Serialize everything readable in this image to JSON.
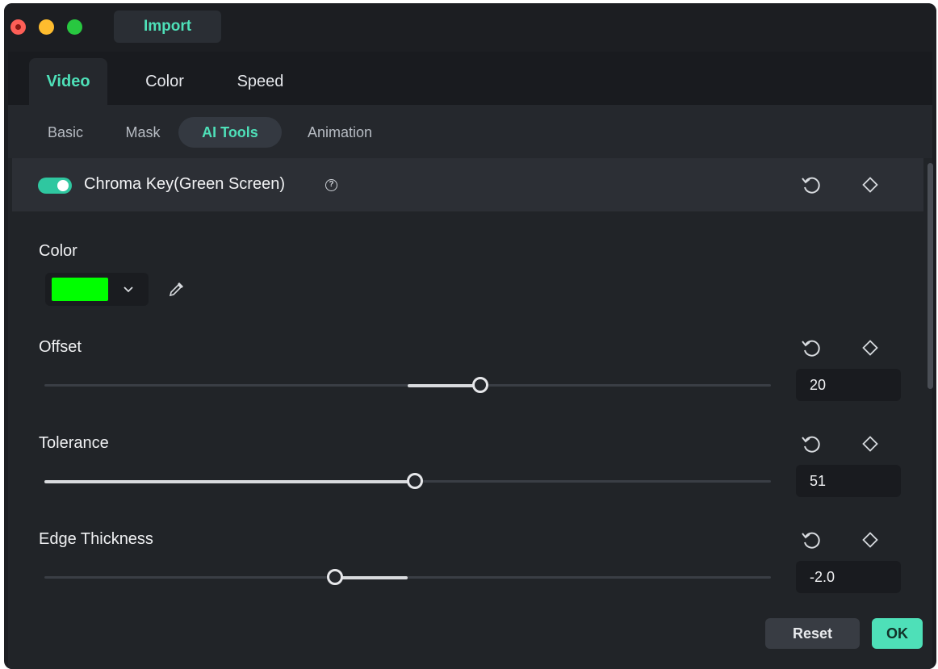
{
  "titlebar": {
    "import_label": "Import"
  },
  "tabs": [
    {
      "label": "Video",
      "active": true
    },
    {
      "label": "Color",
      "active": false
    },
    {
      "label": "Speed",
      "active": false
    }
  ],
  "subtabs": [
    {
      "label": "Basic",
      "active": false
    },
    {
      "label": "Mask",
      "active": false
    },
    {
      "label": "AI Tools",
      "active": true
    },
    {
      "label": "Animation",
      "active": false
    }
  ],
  "section": {
    "title": "Chroma Key(Green Screen)",
    "enabled": true,
    "help_glyph": "?"
  },
  "color": {
    "label": "Color",
    "value": "#00ff00"
  },
  "offset": {
    "label": "Offset",
    "value": "20",
    "fill_start": 0.5,
    "fill_end": 0.6
  },
  "tolerance": {
    "label": "Tolerance",
    "value": "51",
    "fill_start": 0.0,
    "fill_end": 0.51
  },
  "edge_thickness": {
    "label": "Edge Thickness",
    "value": "-2.0",
    "fill_start": 0.4,
    "fill_end": 0.5
  },
  "buttons": {
    "reset_label": "Reset",
    "ok_label": "OK"
  },
  "colors": {
    "accent": "#4ee0b8",
    "toggle_on": "#2fc7a0"
  },
  "icons": {
    "reset": "reset-icon",
    "keyframe": "keyframe-diamond-icon",
    "dropdown": "chevron-down-icon",
    "picker": "eyedropper-icon"
  }
}
